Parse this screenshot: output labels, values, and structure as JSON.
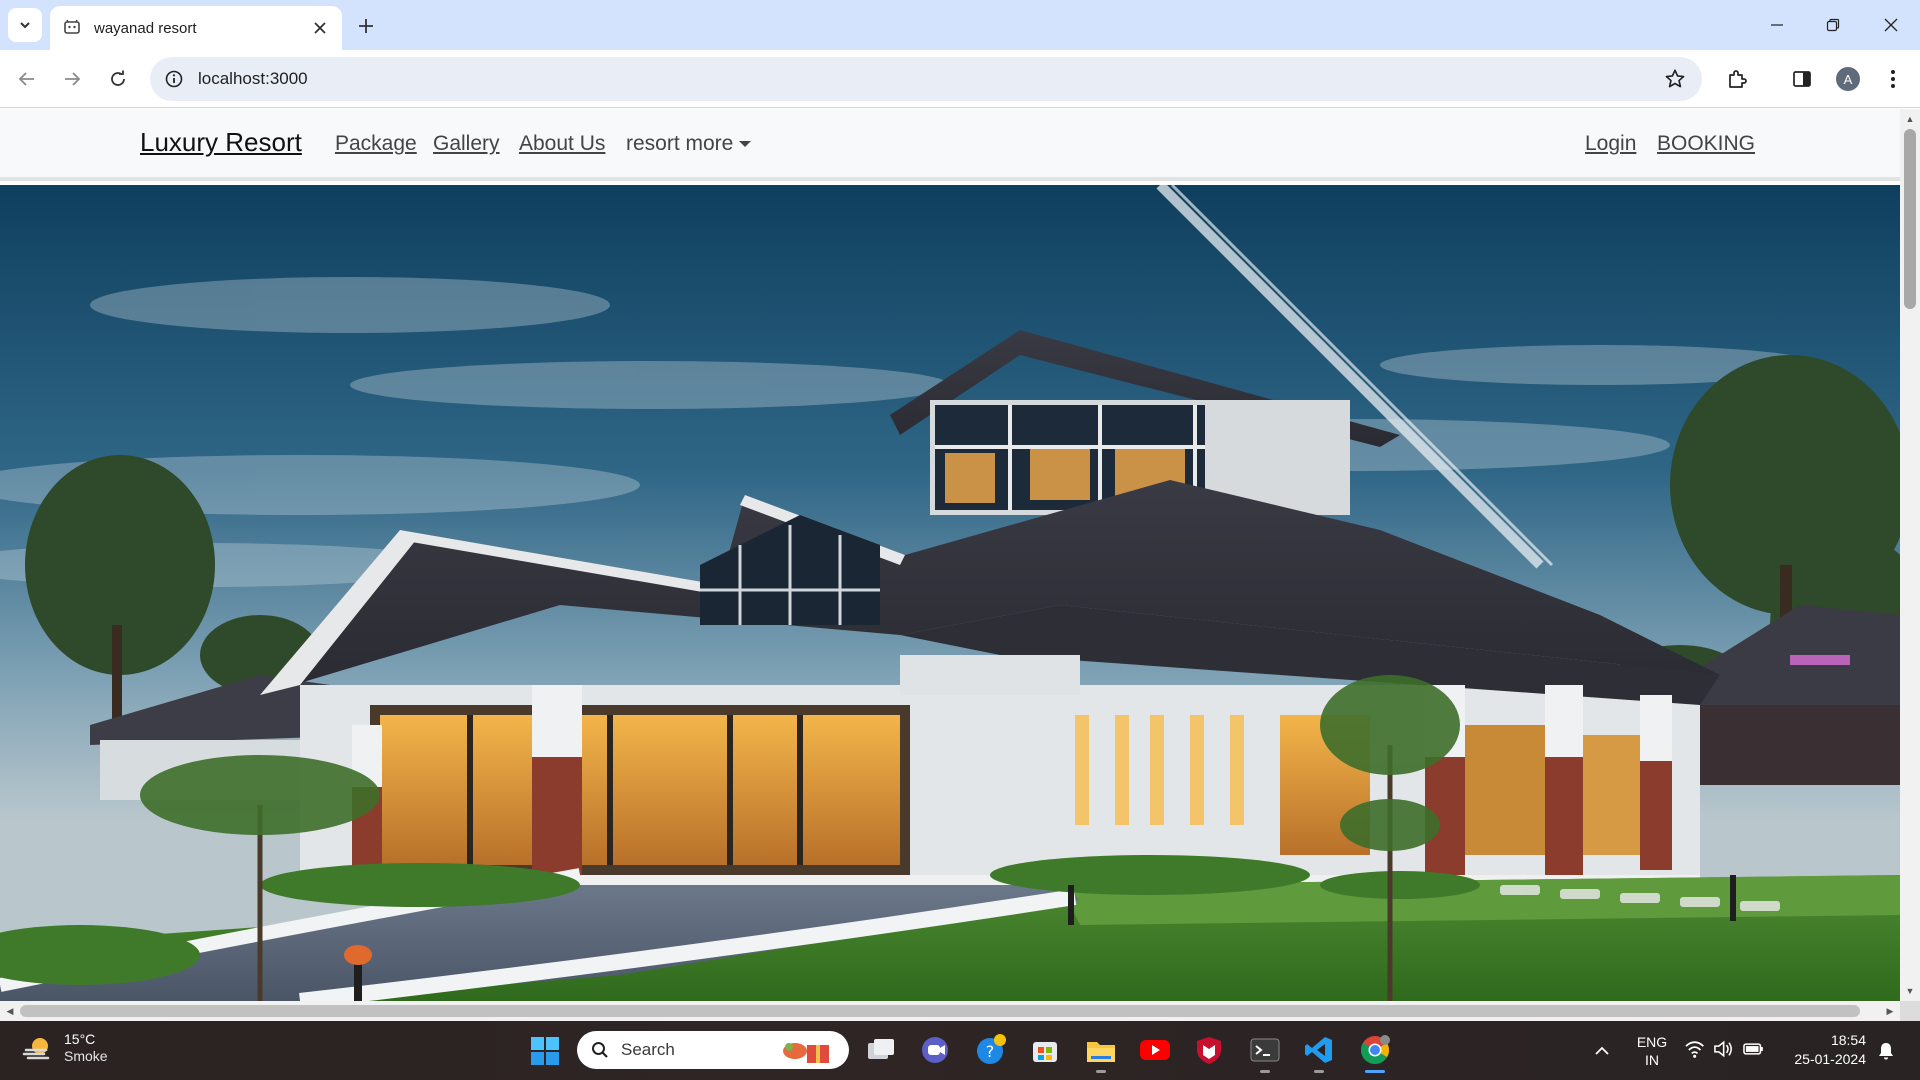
{
  "browser": {
    "tab_title": "wayanad resort",
    "url": "localhost:3000",
    "profile_initial": "A"
  },
  "site": {
    "brand": "Luxury Resort",
    "nav_links": [
      "Package",
      "Gallery",
      "About Us"
    ],
    "dropdown_label": "resort more",
    "right_links": [
      "Login",
      "BOOKING"
    ]
  },
  "taskbar": {
    "weather_temp": "15°C",
    "weather_condition": "Smoke",
    "search_label": "Search",
    "lang_line1": "ENG",
    "lang_line2": "IN",
    "time": "18:54",
    "date": "25-01-2024"
  },
  "colors": {
    "tabstrip": "#d3e3fd",
    "omnibox": "#e9eef6",
    "site_nav_bg": "#f8f9fa",
    "taskbar": "#2a2322",
    "chrome_accent": "#4ea3ff"
  }
}
